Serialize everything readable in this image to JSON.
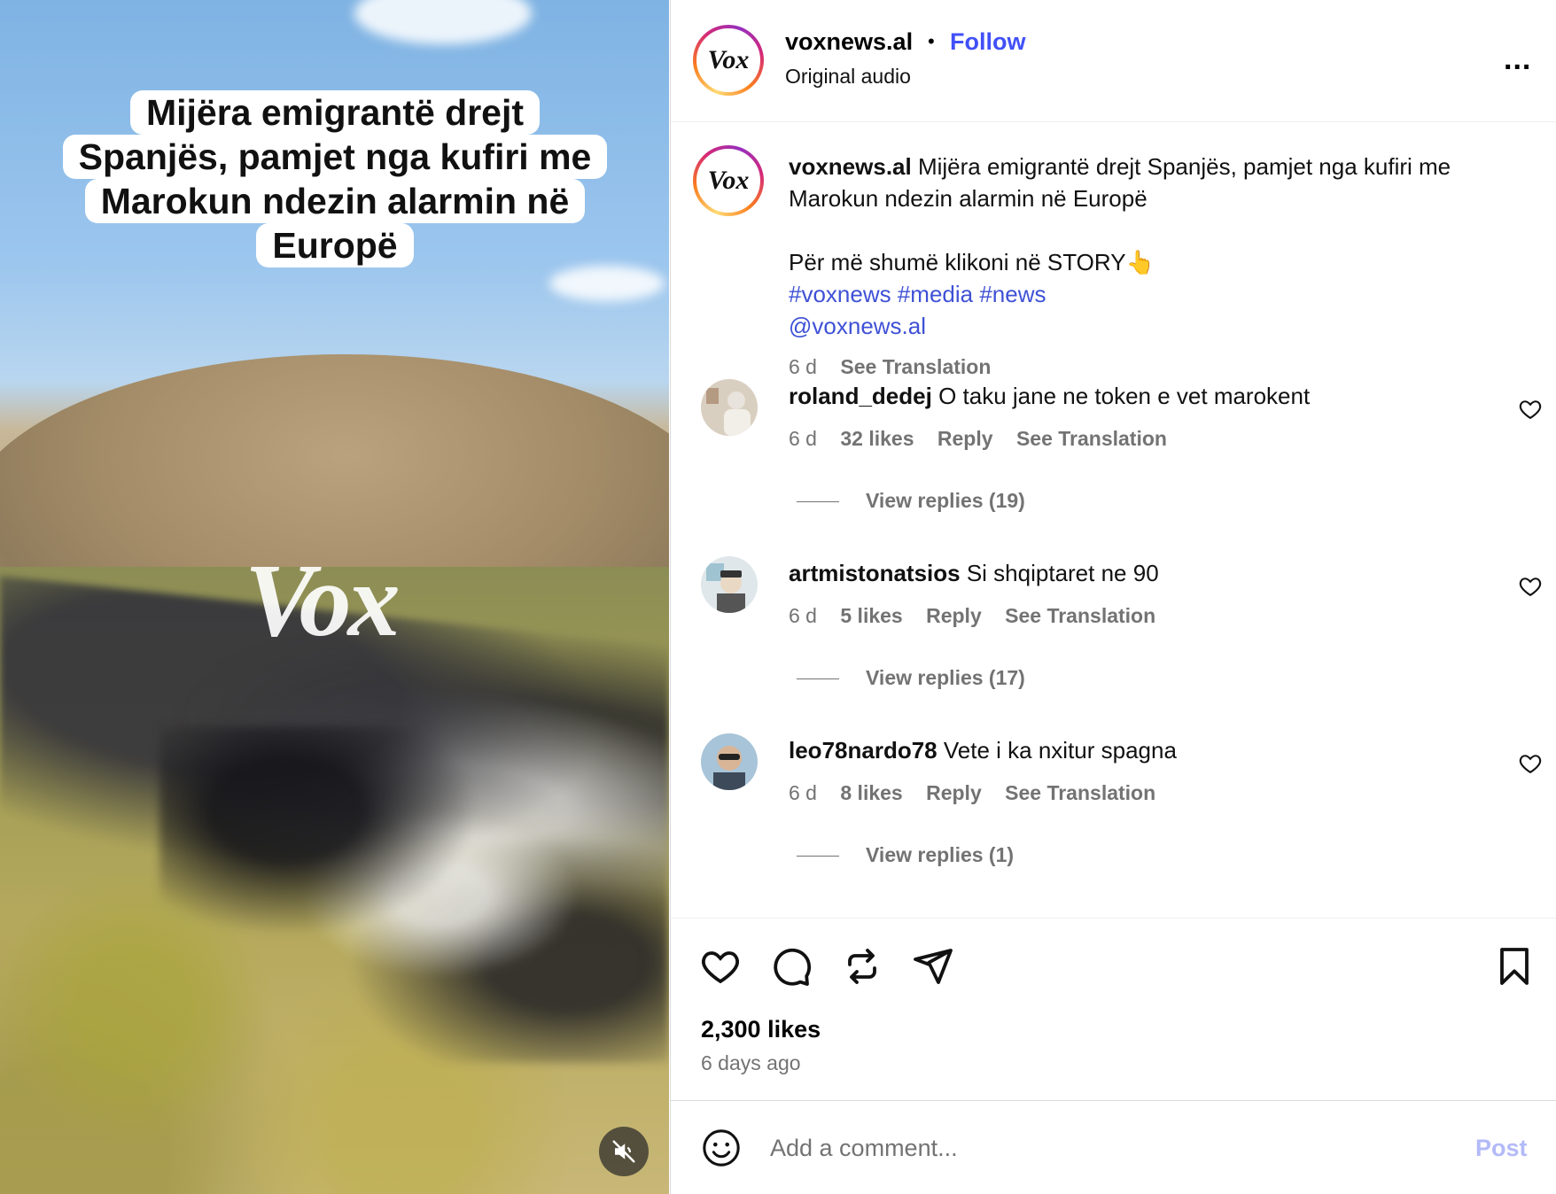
{
  "video": {
    "caption_lines": [
      "Mijëra emigrantë drejt",
      "Spanjës, pamjet nga kufiri me",
      "Marokun ndezin alarmin në",
      "Europë"
    ],
    "watermark": "Vox",
    "mute_icon": "speaker-muted-icon"
  },
  "header": {
    "avatar_text": "Vox",
    "username": "voxnews.al",
    "dot": "•",
    "follow_label": "Follow",
    "audio_label": "Original audio",
    "more_label": "..."
  },
  "caption": {
    "avatar_text": "Vox",
    "username": "voxnews.al",
    "text": "Mijëra emigrantë drejt Spanjës, pamjet nga kufiri me Marokun ndezin alarmin në Europë",
    "line2": "Për më shumë klikoni në STORY👆",
    "hashtags": "#voxnews #media #news",
    "mention": "@voxnews.al",
    "time": "6 d",
    "translate": "See Translation"
  },
  "comments": [
    {
      "username": "roland_dedej",
      "text": "O taku jane ne token e vet marokent",
      "time": "6 d",
      "likes": "32 likes",
      "reply": "Reply",
      "translate": "See Translation",
      "replies": "View replies (19)"
    },
    {
      "username": "artmistonatsios",
      "text": "Si shqiptaret ne 90",
      "time": "6 d",
      "likes": "5 likes",
      "reply": "Reply",
      "translate": "See Translation",
      "replies": "View replies (17)"
    },
    {
      "username": "leo78nardo78",
      "text": "Vete i ka nxitur spagna",
      "time": "6 d",
      "likes": "8 likes",
      "reply": "Reply",
      "translate": "See Translation",
      "replies": "View replies (1)"
    }
  ],
  "actions": {
    "icons": [
      "heart-icon",
      "comment-icon",
      "repost-icon",
      "share-icon",
      "bookmark-icon"
    ],
    "likes": "2,300 likes",
    "time_ago": "6 days ago"
  },
  "comment_bar": {
    "placeholder": "Add a comment...",
    "post_label": "Post"
  },
  "colors": {
    "link": "#4150f7",
    "muted": "#737373",
    "post_disabled": "#b3baf8"
  }
}
